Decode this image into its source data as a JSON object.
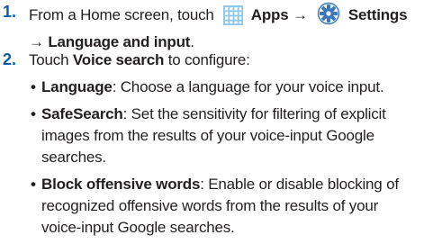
{
  "steps": [
    {
      "number": "1.",
      "intro": "From a Home screen, touch",
      "apps_label": "Apps",
      "arrow1": "→",
      "settings_label": "Settings",
      "arrow2": "→",
      "language_label": "Language and input",
      "period": "."
    },
    {
      "number": "2.",
      "touch": "Touch",
      "voice_search_label": "Voice search",
      "rest": "to configure:"
    }
  ],
  "bullets": [
    {
      "marker": "•",
      "term": "Language",
      "description": ": Choose a language for your voice input."
    },
    {
      "marker": "•",
      "term": "SafeSearch",
      "description": ": Set the sensitivity for filtering of explicit images from the results of your voice-input Google searches."
    },
    {
      "marker": "•",
      "term": "Block offensive words",
      "description": ": Enable or disable blocking of recognized offensive words from the results of your voice-input Google searches."
    }
  ],
  "icons": {
    "apps": "apps-grid-icon",
    "settings": "gear-icon"
  },
  "colors": {
    "step_number": "#0a5ca8",
    "apps_icon": "#8ec8ee",
    "settings_icon": "#3d78b5",
    "text": "#231f20"
  }
}
